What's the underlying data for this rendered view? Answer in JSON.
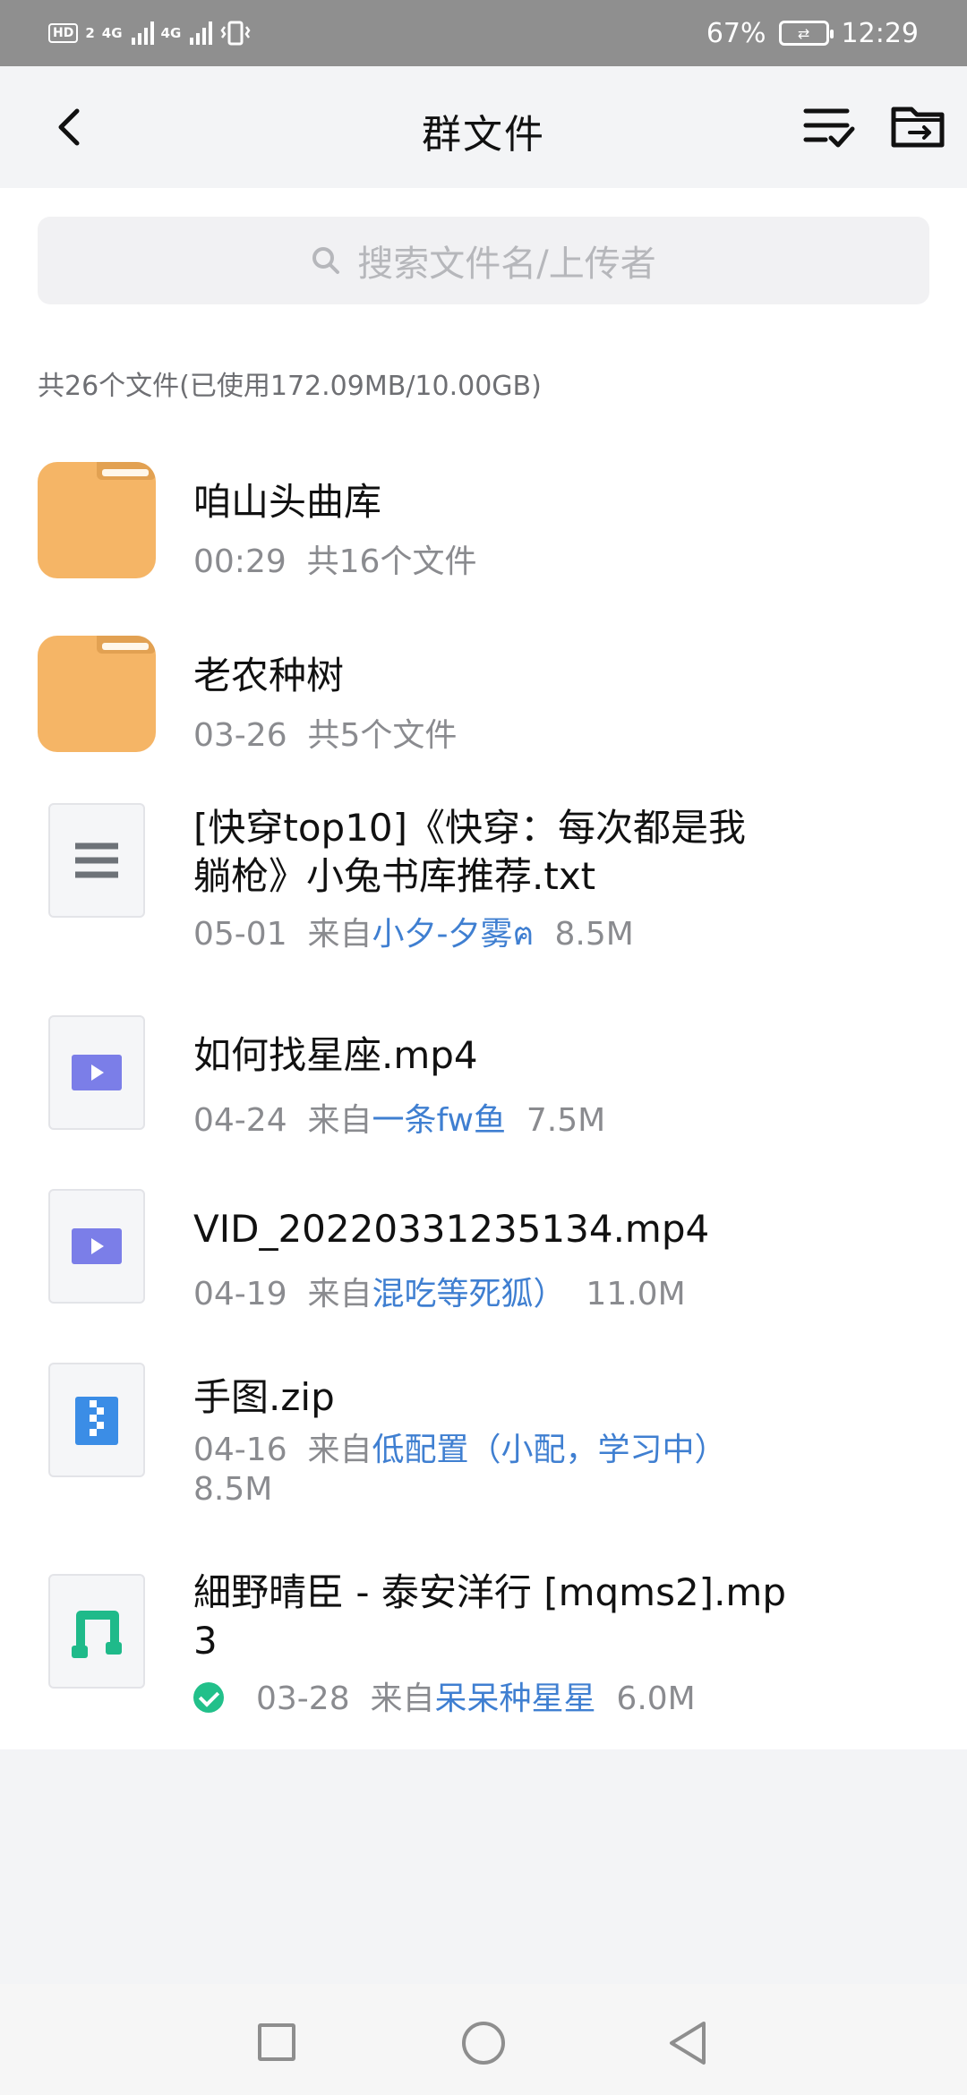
{
  "status_bar": {
    "hd_badge": "HD",
    "sim1": "2",
    "net1": "4G",
    "net2": "4G",
    "battery_percent": "67%",
    "time": "12:29"
  },
  "header": {
    "title": "群文件",
    "icons": [
      "back-icon",
      "multi-select-icon",
      "folder-move-icon"
    ]
  },
  "search": {
    "placeholder": "搜索文件名/上传者"
  },
  "summary": "共26个文件(已使用172.09MB/10.00GB)",
  "files": [
    {
      "type": "folder",
      "name": "咱山头曲库",
      "date": "00:29",
      "count": "共16个文件"
    },
    {
      "type": "folder",
      "name": "老农种树",
      "date": "03-26",
      "count": "共5个文件"
    },
    {
      "type": "txt",
      "name_line1": "[快穿top10]《快穿：每次都是我",
      "name_line2": "躺枪》小兔书库推荐.txt",
      "date": "05-01",
      "from_label": "来自",
      "uploader": "小夕-夕雾ฅ",
      "size": "8.5M"
    },
    {
      "type": "video",
      "name": "如何找星座.mp4",
      "date": "04-24",
      "from_label": "来自",
      "uploader": "一条fw鱼",
      "size": "7.5M"
    },
    {
      "type": "video",
      "name": "VID_20220331235134.mp4",
      "date": "04-19",
      "from_label": "来自",
      "uploader": "混吃等死狐）",
      "size": "11.0M"
    },
    {
      "type": "zip",
      "name": "手图.zip",
      "date": "04-16",
      "from_label": "来自",
      "uploader": "低配置（小配，学习中）",
      "size": "8.5M"
    },
    {
      "type": "audio",
      "name_line1": "細野晴臣 - 泰安洋行 [mqms2].mp",
      "name_line2": "3",
      "downloaded": true,
      "date": "03-28",
      "from_label": "来自",
      "uploader": "呆呆种星星",
      "size": "6.0M"
    }
  ],
  "colors": {
    "folder": "#f5b566",
    "uploader_link": "#3f7fd1",
    "video_icon": "#7b7ee8",
    "zip_icon": "#3b8de6",
    "audio_icon": "#1fba8a",
    "check": "#22c08a"
  },
  "navbar": {
    "icons": [
      "recent-apps-icon",
      "home-icon",
      "back-nav-icon"
    ]
  }
}
